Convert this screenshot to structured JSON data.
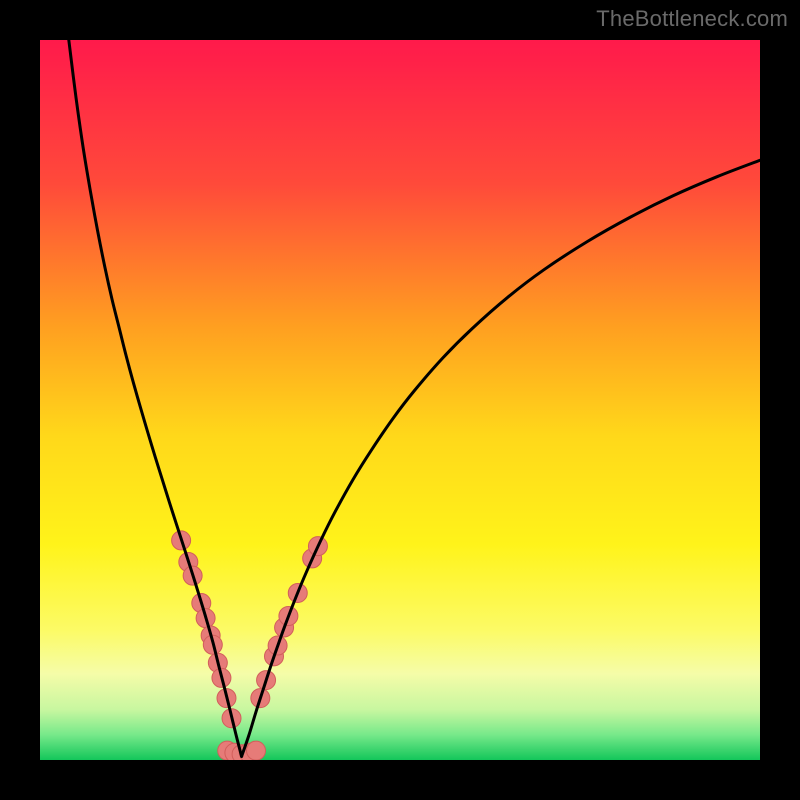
{
  "watermark": "TheBottleneck.com",
  "colors": {
    "frame": "#000000",
    "curve": "#000000",
    "marker_fill": "#e67b78",
    "marker_stroke": "#d25e5b",
    "gradient_stops": [
      {
        "offset": 0.0,
        "color": "#ff1a4b"
      },
      {
        "offset": 0.2,
        "color": "#ff4a3a"
      },
      {
        "offset": 0.4,
        "color": "#ffa020"
      },
      {
        "offset": 0.55,
        "color": "#ffd81a"
      },
      {
        "offset": 0.7,
        "color": "#fff31a"
      },
      {
        "offset": 0.82,
        "color": "#fcfb66"
      },
      {
        "offset": 0.88,
        "color": "#f5fca8"
      },
      {
        "offset": 0.93,
        "color": "#c8f7a0"
      },
      {
        "offset": 0.965,
        "color": "#77e98a"
      },
      {
        "offset": 1.0,
        "color": "#13c65a"
      }
    ]
  },
  "chart_data": {
    "type": "line",
    "title": "",
    "xlabel": "",
    "ylabel": "",
    "xlim": [
      0,
      100
    ],
    "ylim": [
      0,
      100
    ],
    "series": [
      {
        "name": "left-branch",
        "x": [
          4,
          5,
          6,
          7,
          8,
          9,
          10,
          11,
          12,
          13,
          14,
          15,
          16,
          17,
          18,
          19,
          20,
          21,
          22,
          23,
          24,
          24.8,
          25.6,
          26.4,
          27.2,
          28
        ],
        "y": [
          100,
          92,
          85,
          79,
          73.5,
          68.5,
          64,
          60,
          56,
          52.3,
          48.8,
          45.4,
          42.1,
          38.9,
          35.7,
          32.6,
          29.5,
          26.4,
          23.2,
          19.9,
          16.4,
          13.2,
          10.1,
          6.9,
          3.6,
          0.5
        ]
      },
      {
        "name": "right-branch",
        "x": [
          28,
          29,
          30,
          31,
          32,
          33,
          34,
          35.5,
          37,
          39,
          41,
          43.5,
          46,
          49,
          52,
          56,
          60,
          65,
          70,
          76,
          82,
          88,
          94,
          100
        ],
        "y": [
          0.5,
          3.4,
          6.7,
          9.8,
          12.9,
          15.8,
          18.6,
          22.5,
          26.1,
          30.5,
          34.5,
          39,
          43,
          47.4,
          51.3,
          55.9,
          59.9,
          64.3,
          68.1,
          72,
          75.4,
          78.4,
          81,
          83.3
        ]
      }
    ],
    "markers": {
      "name": "highlight-points",
      "points": [
        {
          "x": 19.6,
          "y": 30.5
        },
        {
          "x": 20.6,
          "y": 27.5
        },
        {
          "x": 21.2,
          "y": 25.6
        },
        {
          "x": 22.4,
          "y": 21.8
        },
        {
          "x": 23.0,
          "y": 19.7
        },
        {
          "x": 23.7,
          "y": 17.3
        },
        {
          "x": 24.0,
          "y": 16.0
        },
        {
          "x": 24.7,
          "y": 13.5
        },
        {
          "x": 25.2,
          "y": 11.4
        },
        {
          "x": 25.9,
          "y": 8.6
        },
        {
          "x": 26.6,
          "y": 5.8
        },
        {
          "x": 26.0,
          "y": 1.3
        },
        {
          "x": 27.0,
          "y": 1.0
        },
        {
          "x": 28.0,
          "y": 0.8
        },
        {
          "x": 29.0,
          "y": 1.0
        },
        {
          "x": 30.0,
          "y": 1.3
        },
        {
          "x": 30.6,
          "y": 8.6
        },
        {
          "x": 31.4,
          "y": 11.1
        },
        {
          "x": 32.5,
          "y": 14.4
        },
        {
          "x": 33.0,
          "y": 15.9
        },
        {
          "x": 33.9,
          "y": 18.4
        },
        {
          "x": 34.5,
          "y": 20.0
        },
        {
          "x": 35.8,
          "y": 23.2
        },
        {
          "x": 37.8,
          "y": 28.0
        },
        {
          "x": 38.6,
          "y": 29.7
        }
      ],
      "radius": 9.5
    }
  }
}
